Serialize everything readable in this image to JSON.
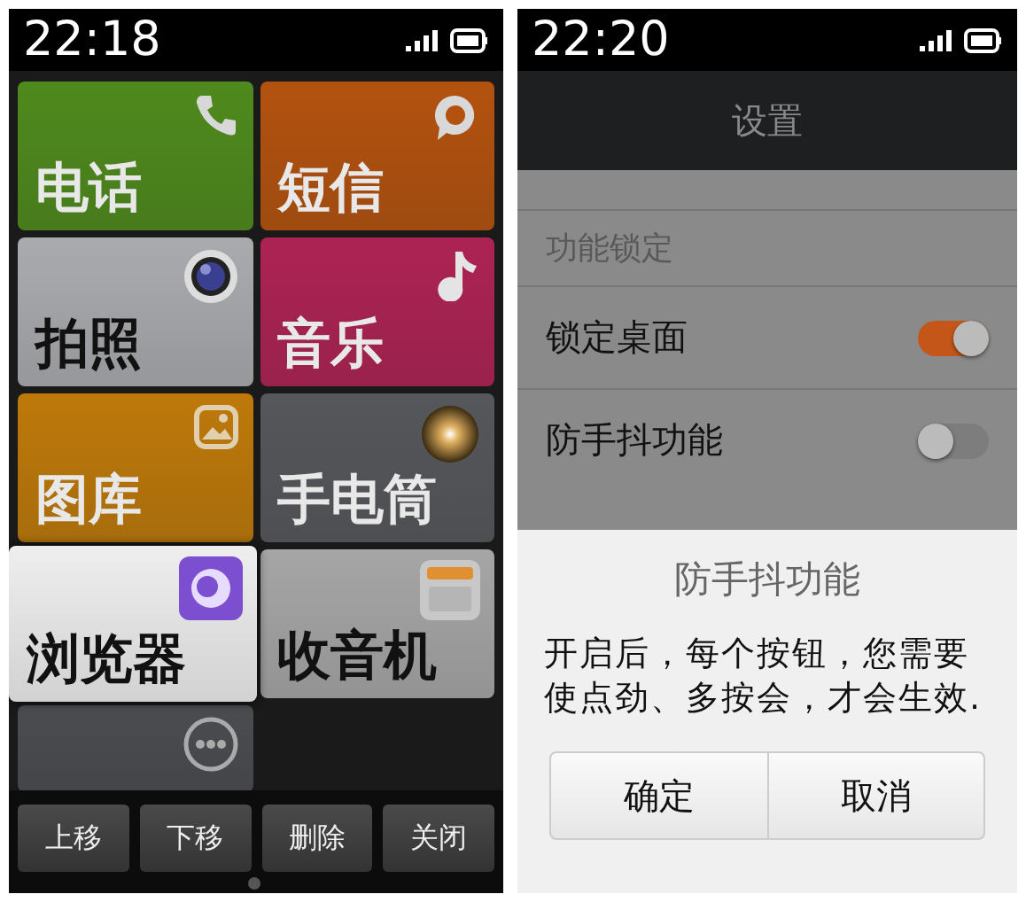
{
  "left_phone": {
    "status_bar": {
      "time": "22:18"
    },
    "tiles": [
      {
        "label": "电话",
        "kind": "phone",
        "color": "#4f8a1d",
        "selected": false
      },
      {
        "label": "短信",
        "kind": "message",
        "color": "#b3520f",
        "selected": false
      },
      {
        "label": "拍照",
        "kind": "camera",
        "color": "#a9abae",
        "selected": false
      },
      {
        "label": "音乐",
        "kind": "music",
        "color": "#ad2353",
        "selected": false
      },
      {
        "label": "图库",
        "kind": "gallery",
        "color": "#be790a",
        "selected": false
      },
      {
        "label": "手电筒",
        "kind": "flashlight",
        "color": "#55575b",
        "selected": false
      },
      {
        "label": "浏览器",
        "kind": "browser",
        "color": "#eeeeee",
        "selected": true
      },
      {
        "label": "收音机",
        "kind": "radio",
        "color": "#a6a6a6",
        "selected": false
      },
      {
        "kind": "more",
        "color": "#4a4c50",
        "selected": false
      }
    ],
    "bottom_buttons": [
      "上移",
      "下移",
      "删除",
      "关闭"
    ]
  },
  "right_phone": {
    "status_bar": {
      "time": "22:20"
    },
    "header": {
      "title": "设置"
    },
    "settings": [
      {
        "kind": "section",
        "label": "功能锁定"
      },
      {
        "kind": "toggle",
        "label": "锁定桌面",
        "on": true
      },
      {
        "kind": "toggle",
        "label": "防手抖功能",
        "on": false
      }
    ],
    "dialog": {
      "title": "防手抖功能",
      "message": "开启后，每个按钮，您需要使点劲、多按会，才会生效.",
      "buttons": [
        "确定",
        "取消"
      ]
    }
  }
}
